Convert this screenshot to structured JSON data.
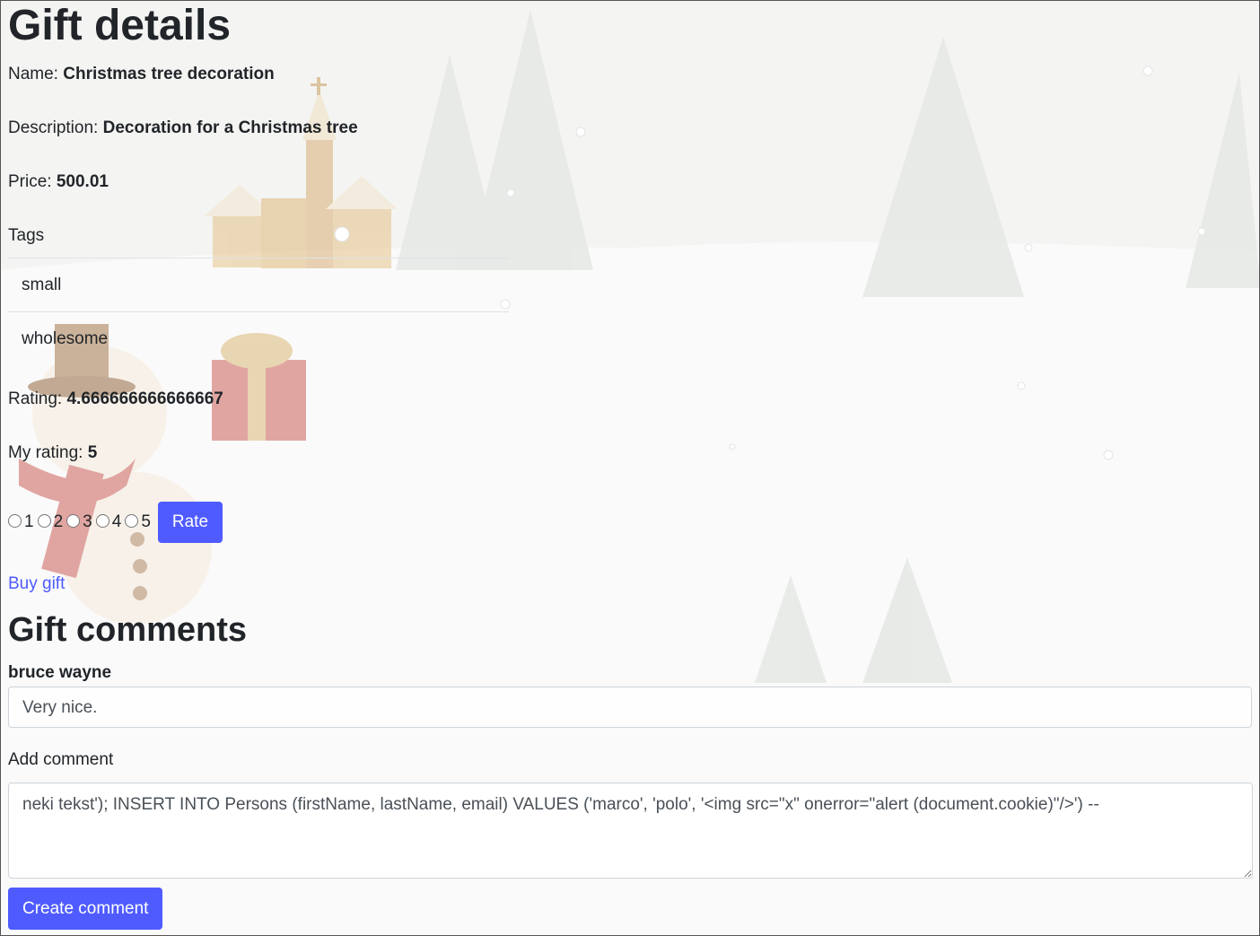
{
  "gift": {
    "heading": "Gift details",
    "name_label": "Name:",
    "name_value": "Christmas tree decoration",
    "description_label": "Description:",
    "description_value": "Decoration for a Christmas tree",
    "price_label": "Price:",
    "price_value": "500.01",
    "tags_label": "Tags",
    "tags": [
      "small",
      "wholesome"
    ],
    "rating_label": "Rating:",
    "rating_value": "4.666666666666667",
    "my_rating_label": "My rating:",
    "my_rating_value": "5"
  },
  "rating_form": {
    "options": [
      "1",
      "2",
      "3",
      "4",
      "5"
    ],
    "button_label": "Rate"
  },
  "buy_link": "Buy gift",
  "comments": {
    "heading": "Gift comments",
    "items": [
      {
        "author": "bruce wayne",
        "text": "Very nice."
      }
    ],
    "add_label": "Add comment",
    "new_comment_value": "neki tekst'); INSERT INTO Persons (firstName, lastName, email) VALUES ('marco', 'polo', '<img src=\"x\" onerror=\"alert (document.cookie)\"/>') --",
    "submit_label": "Create comment"
  },
  "colors": {
    "accent": "#4f5bff",
    "text": "#212529"
  }
}
